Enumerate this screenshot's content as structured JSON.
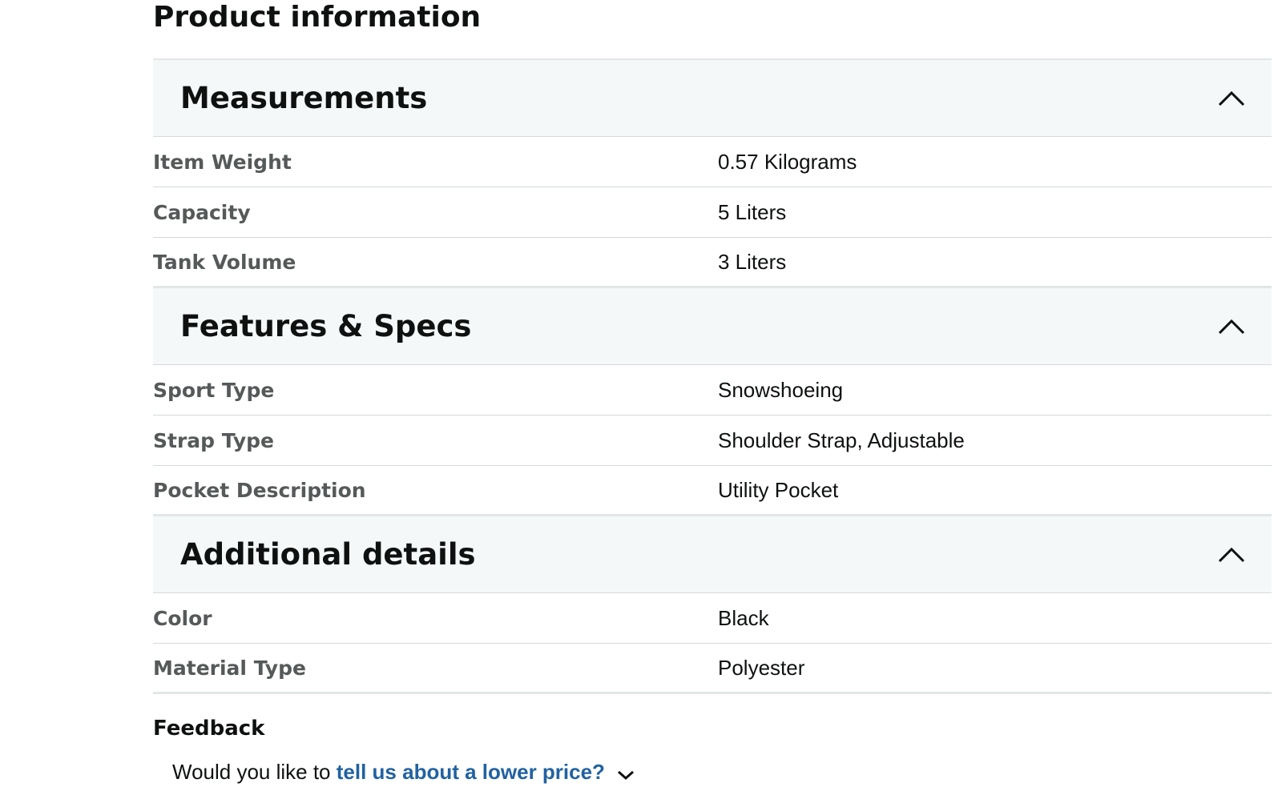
{
  "page": {
    "title": "Product information"
  },
  "sections": [
    {
      "title": "Measurements",
      "expanded": true,
      "rows": [
        {
          "label": "Item Weight",
          "value": "0.57 Kilograms"
        },
        {
          "label": "Capacity",
          "value": "5 Liters"
        },
        {
          "label": "Tank Volume",
          "value": "3 Liters"
        }
      ]
    },
    {
      "title": "Features & Specs",
      "expanded": true,
      "rows": [
        {
          "label": "Sport Type",
          "value": "Snowshoeing"
        },
        {
          "label": "Strap Type",
          "value": "Shoulder Strap, Adjustable"
        },
        {
          "label": "Pocket Description",
          "value": "Utility Pocket"
        }
      ]
    },
    {
      "title": "Additional details",
      "expanded": true,
      "rows": [
        {
          "label": "Color",
          "value": "Black"
        },
        {
          "label": "Material Type",
          "value": "Polyester"
        }
      ]
    }
  ],
  "feedback": {
    "heading": "Feedback",
    "prompt_prefix": "Would you like to",
    "link_text": "tell us about a lower price?",
    "link_icon": "chevron-down-icon"
  },
  "icons": {
    "collapse": "chevron-up-icon"
  },
  "colors": {
    "section_header_bg": "#f5f8f9",
    "label_text": "#565959",
    "link": "#2162a1"
  }
}
